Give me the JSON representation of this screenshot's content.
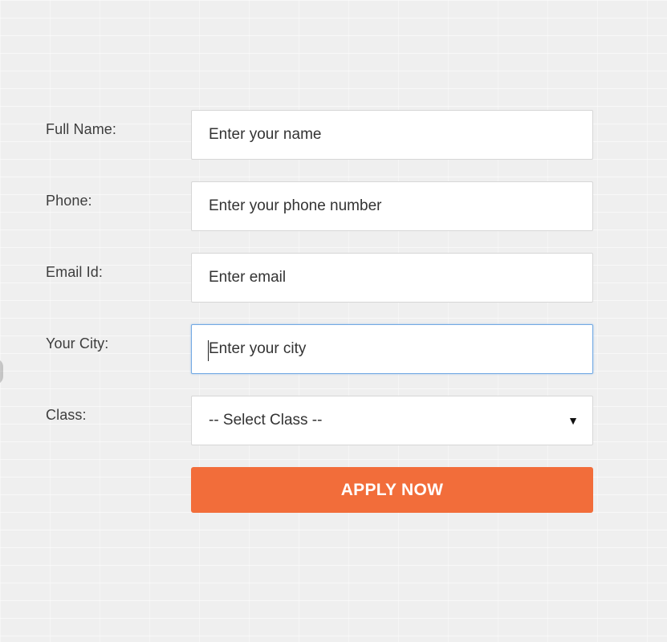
{
  "form": {
    "full_name": {
      "label": "Full Name:",
      "placeholder": "Enter your name"
    },
    "phone": {
      "label": "Phone:",
      "placeholder": "Enter your phone number"
    },
    "email": {
      "label": "Email Id:",
      "placeholder": "Enter email"
    },
    "city": {
      "label": "Your City:",
      "placeholder": "Enter your city",
      "focused": true
    },
    "class_select": {
      "label": "Class:",
      "selected": "-- Select Class --",
      "arrow_icon": "dropdown-arrow-icon"
    },
    "submit_label": "APPLY NOW"
  },
  "colors": {
    "background": "#efefef",
    "button": "#f26d3a",
    "button_text": "#ffffff",
    "focus_border": "#72a9e3",
    "label_text": "#3d3d3d"
  }
}
